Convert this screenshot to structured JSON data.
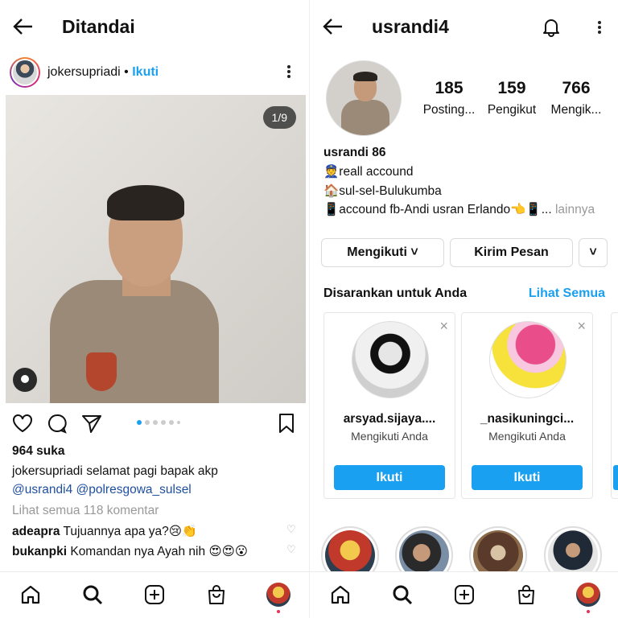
{
  "left": {
    "header_title": "Ditandai",
    "post": {
      "username": "jokersupriadi",
      "separator": " • ",
      "follow_label": "Ikuti",
      "image_counter": "1/9",
      "likes": "964 suka",
      "caption_user": "jokersupriadi",
      "caption_text": " selamat pagi bapak akp",
      "mentions": "@usrandi4 @polresgowa_sulsel",
      "view_comments": "Lihat semua 118 komentar",
      "comments": [
        {
          "user": "adeapra",
          "text": " Tujuannya apa ya?😢👏"
        },
        {
          "user": "bukanpki",
          "text": " Komandan nya Ayah nih 😍😍😮"
        }
      ],
      "carousel_total": 6,
      "carousel_active": 0
    }
  },
  "right": {
    "header_title": "usrandi4",
    "stats": [
      {
        "number": "185",
        "label": "Posting..."
      },
      {
        "number": "159",
        "label": "Pengikut"
      },
      {
        "number": "766",
        "label": "Mengik..."
      }
    ],
    "display_name": "usrandi 86",
    "bio": [
      "👮reall accound",
      "🏠sul-sel-Bulukumba",
      "📱accound fb-Andi usran Erlando👈📱..."
    ],
    "bio_more": " lainnya",
    "buttons": {
      "following": "Mengikuti ˅",
      "message": "Kirim Pesan",
      "more": "˅"
    },
    "suggested_title": "Disarankan untuk Anda",
    "see_all": "Lihat Semua",
    "suggestions": [
      {
        "name": "arsyad.sijaya....",
        "sub": "Mengikuti Anda",
        "button": "Ikuti",
        "close": "×"
      },
      {
        "name": "_nasikuningci...",
        "sub": "Mengikuti Anda",
        "button": "Ikuti",
        "close": "×"
      }
    ]
  },
  "colors": {
    "accent": "#1aa0f0",
    "mention": "#1f4fa0",
    "notification_dot": "#e8325a"
  },
  "icons": [
    "back-arrow-icon",
    "kebab-menu-icon",
    "heart-icon",
    "comment-icon",
    "send-icon",
    "bookmark-icon",
    "home-icon",
    "search-icon",
    "add-post-icon",
    "shop-icon",
    "bell-icon",
    "tag-person-icon",
    "close-icon"
  ]
}
